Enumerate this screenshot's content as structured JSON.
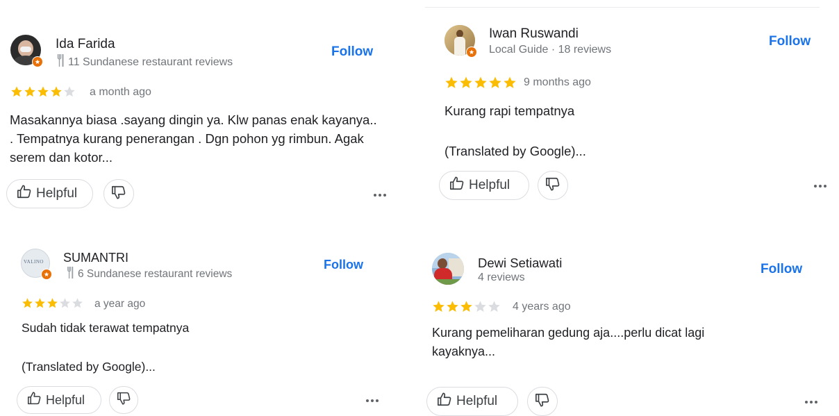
{
  "reviews": [
    {
      "name": "Ida Farida",
      "subtitle": "11 Sundanese restaurant reviews",
      "has_fork_icon": true,
      "follow_label": "Follow",
      "rating": 4,
      "time": "a month ago",
      "text": "Masakannya biasa  .sayang dingin ya. Klw panas enak kayanya.. .  Tempatnya kurang penerangan . Dgn pohon yg rimbun. Agak serem dan kotor...",
      "helpful_label": "Helpful"
    },
    {
      "name": "Iwan Ruswandi",
      "subtitle": "Local Guide · 18 reviews",
      "has_fork_icon": false,
      "follow_label": "Follow",
      "rating": 5,
      "time": "9 months ago",
      "text": "Kurang rapi tempatnya",
      "translated": "(Translated by Google)...",
      "helpful_label": "Helpful"
    },
    {
      "name": "SUMANTRI",
      "subtitle": "6 Sundanese restaurant reviews",
      "has_fork_icon": true,
      "follow_label": "Follow",
      "rating": 3,
      "time": "a year ago",
      "text": "Sudah tidak terawat tempatnya",
      "translated": "(Translated by Google)...",
      "helpful_label": "Helpful",
      "avatar_text": "VALINO"
    },
    {
      "name": "Dewi Setiawati",
      "subtitle": "4 reviews",
      "has_fork_icon": false,
      "follow_label": "Follow",
      "rating": 3,
      "time": "4 years ago",
      "text": "Kurang pemeliharan gedung aja....perlu dicat lagi kayaknya...",
      "helpful_label": "Helpful"
    }
  ],
  "colors": {
    "star_filled": "#fbbc04",
    "star_empty": "#dadce0",
    "follow": "#1a73e8",
    "badge": "#e8710a"
  },
  "icons": [
    "fork-knife-icon",
    "star-icon",
    "thumbs-up-icon",
    "thumbs-down-icon",
    "more-options-icon",
    "local-guide-badge-icon"
  ]
}
